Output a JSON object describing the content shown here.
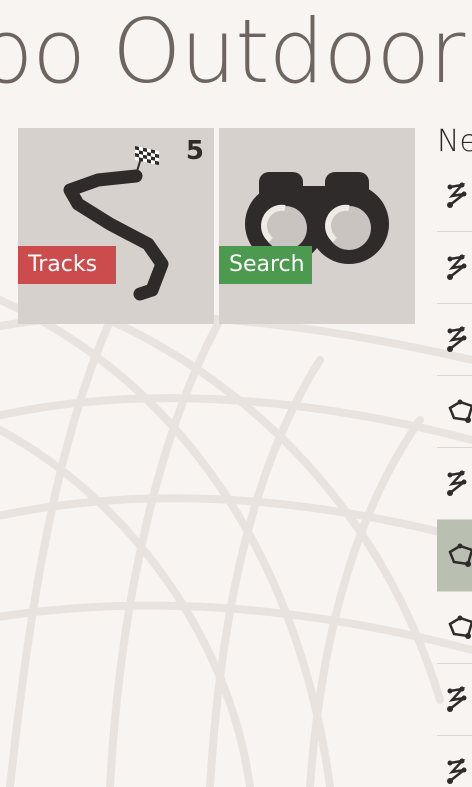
{
  "app": {
    "title": "loo Outdoor"
  },
  "tiles": [
    {
      "id": "tracks",
      "label": "Tracks",
      "count": "5",
      "icon": "winding-track-flag-icon",
      "color": "#cc4b4d"
    },
    {
      "id": "search",
      "label": "Search",
      "icon": "binoculars-icon",
      "color": "#4c9a4f"
    }
  ],
  "list": {
    "header": "Ne",
    "items": [
      {
        "icon": "track-line-icon",
        "selected": false
      },
      {
        "icon": "track-line-icon",
        "selected": false
      },
      {
        "icon": "track-line-icon",
        "selected": false
      },
      {
        "icon": "track-loop-icon",
        "selected": false
      },
      {
        "icon": "track-line-icon",
        "selected": false
      },
      {
        "icon": "track-loop-icon",
        "selected": true
      },
      {
        "icon": "track-loop-icon",
        "selected": false
      },
      {
        "icon": "track-line-icon",
        "selected": false
      },
      {
        "icon": "track-line-icon",
        "selected": false
      }
    ]
  }
}
